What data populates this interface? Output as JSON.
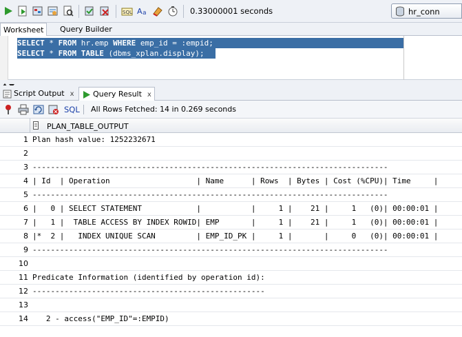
{
  "toolbar": {
    "elapsed": "0.33000001 seconds",
    "connection": "hr_conn"
  },
  "worksheet_tabs": [
    {
      "label": "Worksheet"
    },
    {
      "label": "Query Builder"
    }
  ],
  "editor": {
    "lines": [
      {
        "kw1": "SELECT",
        "t1": " * ",
        "kw2": "FROM",
        "t2": " hr.emp ",
        "kw3": "WHERE",
        "t3": " emp_id = :empid;"
      },
      {
        "kw1": "SELECT",
        "t1": " * ",
        "kw2": "FROM",
        "t2": " ",
        "kw3": "TABLE",
        "t3": " (dbms_xplan.display);"
      }
    ]
  },
  "result_tabs": [
    {
      "label": "Script Output",
      "close": "x"
    },
    {
      "label": "Query Result",
      "close": "x"
    }
  ],
  "result_toolbar": {
    "sql_label": "SQL",
    "fetch_status": "All Rows Fetched: 14 in 0.269 seconds"
  },
  "grid": {
    "column": "PLAN_TABLE_OUTPUT",
    "rows": [
      {
        "n": "1",
        "v": "Plan hash value: 1252232671"
      },
      {
        "n": "2",
        "v": ""
      },
      {
        "n": "3",
        "v": "------------------------------------------------------------------------------"
      },
      {
        "n": "4",
        "v": "| Id  | Operation                   | Name      | Rows  | Bytes | Cost (%CPU)| Time     |"
      },
      {
        "n": "5",
        "v": "------------------------------------------------------------------------------"
      },
      {
        "n": "6",
        "v": "|   0 | SELECT STATEMENT            |           |     1 |    21 |     1   (0)| 00:00:01 |"
      },
      {
        "n": "7",
        "v": "|   1 |  TABLE ACCESS BY INDEX ROWID| EMP       |     1 |    21 |     1   (0)| 00:00:01 |"
      },
      {
        "n": "8",
        "v": "|*  2 |   INDEX UNIQUE SCAN         | EMP_ID_PK |     1 |       |     0   (0)| 00:00:01 |"
      },
      {
        "n": "9",
        "v": "------------------------------------------------------------------------------"
      },
      {
        "n": "10",
        "v": ""
      },
      {
        "n": "11",
        "v": "Predicate Information (identified by operation id):"
      },
      {
        "n": "12",
        "v": "---------------------------------------------------"
      },
      {
        "n": "13",
        "v": ""
      },
      {
        "n": "14",
        "v": "   2 - access(\"EMP_ID\"=:EMPID)"
      }
    ]
  }
}
